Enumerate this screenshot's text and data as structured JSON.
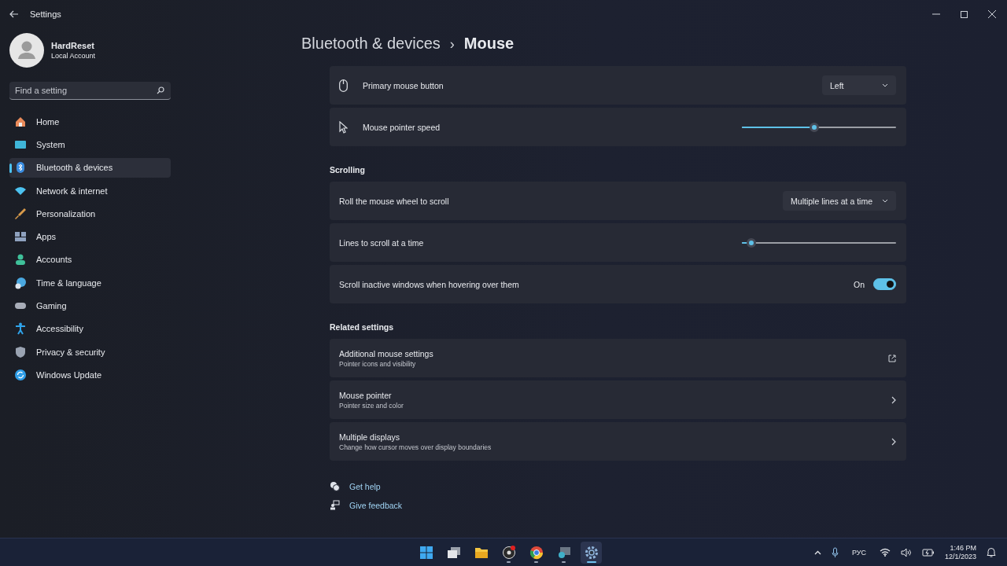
{
  "window": {
    "title": "Settings"
  },
  "account": {
    "name": "HardReset",
    "type": "Local Account"
  },
  "search": {
    "placeholder": "Find a setting"
  },
  "nav": [
    {
      "label": "Home",
      "selected": false
    },
    {
      "label": "System",
      "selected": false
    },
    {
      "label": "Bluetooth & devices",
      "selected": true
    },
    {
      "label": "Network & internet",
      "selected": false
    },
    {
      "label": "Personalization",
      "selected": false
    },
    {
      "label": "Apps",
      "selected": false
    },
    {
      "label": "Accounts",
      "selected": false
    },
    {
      "label": "Time & language",
      "selected": false
    },
    {
      "label": "Gaming",
      "selected": false
    },
    {
      "label": "Accessibility",
      "selected": false
    },
    {
      "label": "Privacy & security",
      "selected": false
    },
    {
      "label": "Windows Update",
      "selected": false
    }
  ],
  "breadcrumb": {
    "parent": "Bluetooth & devices",
    "separator": "›",
    "current": "Mouse"
  },
  "sections": [
    {
      "rows": [
        {
          "kind": "dropdown",
          "label": "Primary mouse button",
          "value": "Left"
        },
        {
          "kind": "slider",
          "label": "Mouse pointer speed",
          "level": 0.47
        }
      ]
    },
    {
      "heading": "Scrolling",
      "rows": [
        {
          "kind": "dropdown",
          "label": "Roll the mouse wheel to scroll",
          "value": "Multiple lines at a time"
        },
        {
          "kind": "slider",
          "label": "Lines to scroll at a time",
          "level": 0.06
        },
        {
          "kind": "toggle",
          "label": "Scroll inactive windows when hovering over them",
          "state_text": "On",
          "on": true
        }
      ]
    },
    {
      "heading": "Related settings",
      "rows": [
        {
          "kind": "external",
          "label": "Additional mouse settings",
          "sub": "Pointer icons and visibility"
        },
        {
          "kind": "link",
          "label": "Mouse pointer",
          "sub": "Pointer size and color"
        },
        {
          "kind": "link",
          "label": "Multiple displays",
          "sub": "Change how cursor moves over display boundaries"
        }
      ]
    }
  ],
  "help_links": [
    {
      "label": "Get help"
    },
    {
      "label": "Give feedback"
    }
  ],
  "taskbar": {
    "apps": [
      {
        "running": false,
        "selected": false
      },
      {
        "running": false,
        "selected": false
      },
      {
        "running": false,
        "selected": false
      },
      {
        "running": true,
        "selected": false
      },
      {
        "running": true,
        "selected": false
      },
      {
        "running": true,
        "selected": false
      },
      {
        "running": true,
        "selected": true
      }
    ],
    "language": "РУС",
    "time": "1:46 PM",
    "date": "12/1/2023"
  }
}
